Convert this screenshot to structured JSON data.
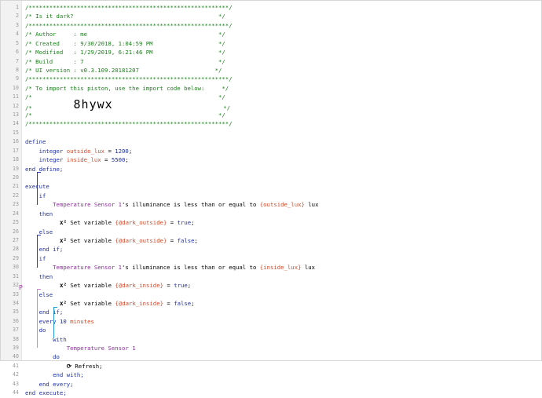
{
  "lines": [
    {
      "num": "1",
      "segs": [
        {
          "t": "comment",
          "v": "/**********************************************************/"
        }
      ]
    },
    {
      "num": "2",
      "segs": [
        {
          "t": "comment",
          "v": "/* Is it dark?                                          */"
        }
      ]
    },
    {
      "num": "3",
      "segs": [
        {
          "t": "comment",
          "v": "/**********************************************************/"
        }
      ]
    },
    {
      "num": "4",
      "segs": [
        {
          "t": "comment",
          "v": "/* Author     : me                                      */"
        }
      ]
    },
    {
      "num": "5",
      "segs": [
        {
          "t": "comment",
          "v": "/* Created    : 9/30/2018, 1:04:59 PM                   */"
        }
      ]
    },
    {
      "num": "6",
      "segs": [
        {
          "t": "comment",
          "v": "/* Modified   : 1/29/2019, 6:21:46 PM                   */"
        }
      ]
    },
    {
      "num": "7",
      "segs": [
        {
          "t": "comment",
          "v": "/* Build      : 7                                       */"
        }
      ]
    },
    {
      "num": "8",
      "segs": [
        {
          "t": "comment",
          "v": "/* UI version : v0.3.109.20181207                      */"
        }
      ]
    },
    {
      "num": "9",
      "segs": [
        {
          "t": "comment",
          "v": "/**********************************************************/"
        }
      ]
    },
    {
      "num": "10",
      "segs": [
        {
          "t": "comment",
          "v": "/* To import this piston, use the import code below:     */"
        }
      ]
    },
    {
      "num": "11",
      "segs": [
        {
          "t": "comment",
          "v": "/*                                                      */"
        }
      ]
    },
    {
      "num": "12",
      "segs": [
        {
          "t": "comment",
          "v": "/*            "
        },
        {
          "t": "code",
          "v": "8hywx"
        },
        {
          "t": "comment",
          "v": "                                */"
        }
      ]
    },
    {
      "num": "13",
      "segs": [
        {
          "t": "comment",
          "v": "/*                                                      */"
        }
      ]
    },
    {
      "num": "14",
      "segs": [
        {
          "t": "comment",
          "v": "/**********************************************************/"
        }
      ]
    },
    {
      "num": "15",
      "segs": []
    },
    {
      "num": "16",
      "segs": [
        {
          "t": "kw",
          "v": "define"
        }
      ]
    },
    {
      "num": "17",
      "segs": [
        {
          "t": "type",
          "v": "    integer "
        },
        {
          "t": "var",
          "v": "outside_lux"
        },
        {
          "t": "plain",
          "v": " = "
        },
        {
          "t": "num",
          "v": "1200"
        },
        {
          "t": "plain",
          "v": ";"
        }
      ]
    },
    {
      "num": "18",
      "segs": [
        {
          "t": "type",
          "v": "    integer "
        },
        {
          "t": "var",
          "v": "inside_lux"
        },
        {
          "t": "plain",
          "v": " = "
        },
        {
          "t": "num",
          "v": "5500"
        },
        {
          "t": "plain",
          "v": ";"
        }
      ]
    },
    {
      "num": "19",
      "segs": [
        {
          "t": "kw",
          "v": "end define;"
        }
      ]
    },
    {
      "num": "20",
      "segs": []
    },
    {
      "num": "21",
      "segs": [
        {
          "t": "kw",
          "v": "execute"
        }
      ]
    },
    {
      "num": "22",
      "segs": [
        {
          "t": "kw",
          "v": "    if"
        }
      ]
    },
    {
      "num": "23",
      "segs": [
        {
          "t": "plain",
          "v": "        "
        },
        {
          "t": "dev",
          "v": "Temperature Sensor 1"
        },
        {
          "t": "plain",
          "v": "'s illuminance is less than or equal to "
        },
        {
          "t": "str",
          "v": "{outside_lux}"
        },
        {
          "t": "plain",
          "v": " lux"
        }
      ]
    },
    {
      "num": "24",
      "segs": [
        {
          "t": "kw",
          "v": "    then"
        }
      ]
    },
    {
      "num": "25",
      "segs": [
        {
          "t": "plain",
          "v": "          "
        },
        {
          "t": "icon",
          "v": "x²"
        },
        {
          "t": "plain",
          "v": " Set variable "
        },
        {
          "t": "str",
          "v": "{@dark_outside}"
        },
        {
          "t": "plain",
          "v": " = "
        },
        {
          "t": "num",
          "v": "true"
        },
        {
          "t": "plain",
          "v": ";"
        }
      ]
    },
    {
      "num": "26",
      "segs": [
        {
          "t": "kw",
          "v": "    else"
        }
      ]
    },
    {
      "num": "27",
      "segs": [
        {
          "t": "plain",
          "v": "          "
        },
        {
          "t": "icon",
          "v": "x²"
        },
        {
          "t": "plain",
          "v": " Set variable "
        },
        {
          "t": "str",
          "v": "{@dark_outside}"
        },
        {
          "t": "plain",
          "v": " = "
        },
        {
          "t": "num",
          "v": "false"
        },
        {
          "t": "plain",
          "v": ";"
        }
      ]
    },
    {
      "num": "28",
      "segs": [
        {
          "t": "kw",
          "v": "    end if;"
        }
      ]
    },
    {
      "num": "29",
      "segs": [
        {
          "t": "kw",
          "v": "    if"
        }
      ]
    },
    {
      "num": "30",
      "segs": [
        {
          "t": "plain",
          "v": "        "
        },
        {
          "t": "dev",
          "v": "Temperature Sensor 1"
        },
        {
          "t": "plain",
          "v": "'s illuminance is less than or equal to "
        },
        {
          "t": "str",
          "v": "{inside_lux}"
        },
        {
          "t": "plain",
          "v": " lux"
        }
      ]
    },
    {
      "num": "31",
      "segs": [
        {
          "t": "kw",
          "v": "    then"
        }
      ]
    },
    {
      "num": "32",
      "segs": [
        {
          "t": "plain",
          "v": "          "
        },
        {
          "t": "icon",
          "v": "x²"
        },
        {
          "t": "plain",
          "v": " Set variable "
        },
        {
          "t": "str",
          "v": "{@dark_inside}"
        },
        {
          "t": "plain",
          "v": " = "
        },
        {
          "t": "num",
          "v": "true"
        },
        {
          "t": "plain",
          "v": ";"
        }
      ]
    },
    {
      "num": "33",
      "segs": [
        {
          "t": "kw",
          "v": "    else"
        }
      ]
    },
    {
      "num": "34",
      "segs": [
        {
          "t": "plain",
          "v": "          "
        },
        {
          "t": "icon",
          "v": "x²"
        },
        {
          "t": "plain",
          "v": " Set variable "
        },
        {
          "t": "str",
          "v": "{@dark_inside}"
        },
        {
          "t": "plain",
          "v": " = "
        },
        {
          "t": "num",
          "v": "false"
        },
        {
          "t": "plain",
          "v": ";"
        }
      ]
    },
    {
      "num": "35",
      "segs": [
        {
          "t": "kw",
          "v": "    end if;"
        }
      ]
    },
    {
      "num": "36",
      "segs": [
        {
          "t": "kw",
          "v": "    every "
        },
        {
          "t": "num",
          "v": "10"
        },
        {
          "t": "var",
          "v": " minutes"
        }
      ]
    },
    {
      "num": "37",
      "segs": [
        {
          "t": "kw",
          "v": "    do"
        }
      ]
    },
    {
      "num": "38",
      "segs": [
        {
          "t": "kw",
          "v": "        with"
        }
      ]
    },
    {
      "num": "39",
      "segs": [
        {
          "t": "plain",
          "v": "            "
        },
        {
          "t": "dev",
          "v": "Temperature Sensor 1"
        }
      ]
    },
    {
      "num": "40",
      "segs": [
        {
          "t": "kw",
          "v": "        do"
        }
      ]
    },
    {
      "num": "41",
      "segs": [
        {
          "t": "plain",
          "v": "            "
        },
        {
          "t": "icon",
          "v": "⟳"
        },
        {
          "t": "plain",
          "v": " Refresh;"
        }
      ]
    },
    {
      "num": "42",
      "segs": [
        {
          "t": "kw",
          "v": "        end with;"
        }
      ]
    },
    {
      "num": "43",
      "segs": [
        {
          "t": "kw",
          "v": "    end every;"
        }
      ]
    },
    {
      "num": "44",
      "segs": [
        {
          "t": "kw",
          "v": "end execute;"
        }
      ]
    }
  ],
  "flag_marker": "P",
  "icons": {
    "variable": "variable-icon",
    "refresh": "refresh-icon"
  }
}
